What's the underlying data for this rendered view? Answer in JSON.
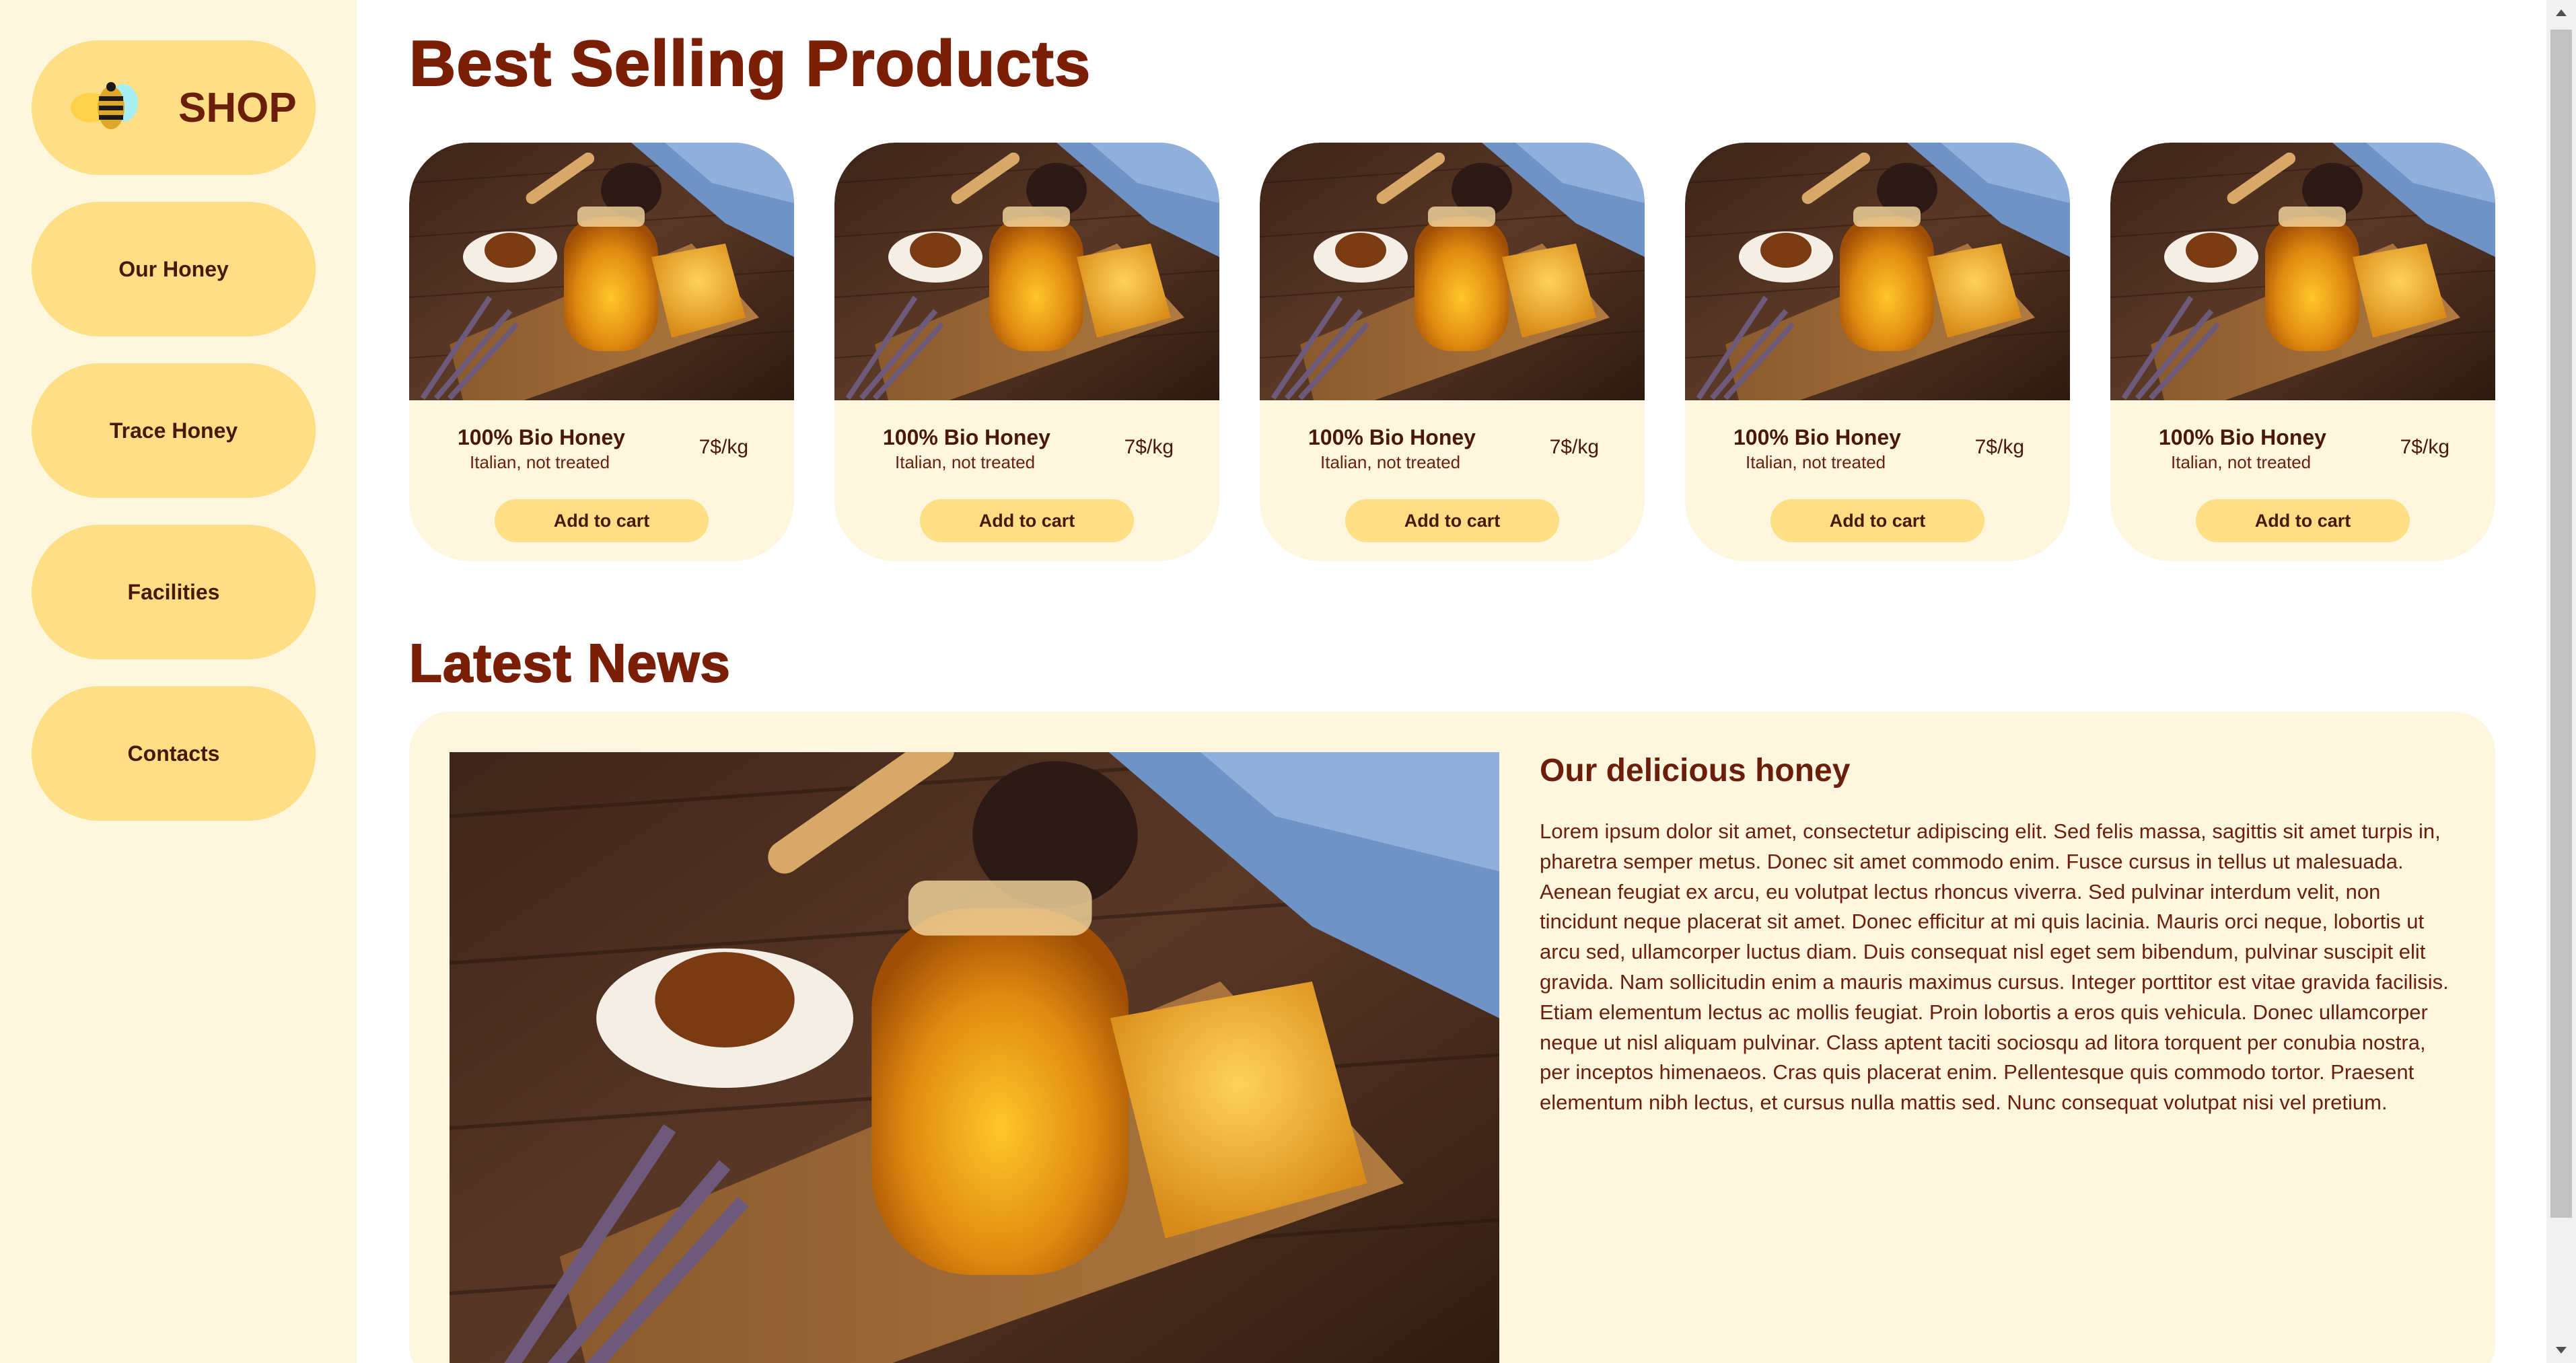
{
  "sidebar": {
    "shop_label": "SHOP",
    "items": [
      {
        "label": "Our Honey"
      },
      {
        "label": "Trace Honey"
      },
      {
        "label": "Facilities"
      },
      {
        "label": "Contacts"
      }
    ]
  },
  "best_selling": {
    "title": "Best Selling Products",
    "products": [
      {
        "name": "100% Bio Honey",
        "subtitle": "Italian, not treated",
        "price": "7$/kg",
        "button": "Add to cart"
      },
      {
        "name": "100% Bio Honey",
        "subtitle": "Italian, not treated",
        "price": "7$/kg",
        "button": "Add to cart"
      },
      {
        "name": "100% Bio Honey",
        "subtitle": "Italian, not treated",
        "price": "7$/kg",
        "button": "Add to cart"
      },
      {
        "name": "100% Bio Honey",
        "subtitle": "Italian, not treated",
        "price": "7$/kg",
        "button": "Add to cart"
      },
      {
        "name": "100% Bio Honey",
        "subtitle": "Italian, not treated",
        "price": "7$/kg",
        "button": "Add to cart"
      }
    ]
  },
  "news": {
    "title": "Latest News",
    "heading": "Our delicious honey",
    "body": "Lorem ipsum dolor sit amet, consectetur adipiscing elit. Sed felis massa, sagittis sit amet turpis in, pharetra semper metus. Donec sit amet commodo enim. Fusce cursus in tellus ut malesuada. Aenean feugiat ex arcu, eu volutpat lectus rhoncus viverra. Sed pulvinar interdum velit, non tincidunt neque placerat sit amet. Donec efficitur at mi quis lacinia. Mauris orci neque, lobortis ut arcu sed, ullamcorper luctus diam. Duis consequat nisl eget sem bibendum, pulvinar suscipit elit gravida. Nam sollicitudin enim a mauris maximus cursus. Integer porttitor est vitae gravida facilisis. Etiam elementum lectus ac mollis feugiat. Proin lobortis a eros quis vehicula. Donec ullamcorper neque ut nisl aliquam pulvinar. Class aptent taciti sociosqu ad litora torquent per conubia nostra, per inceptos himenaeos. Cras quis placerat enim. Pellentesque quis commodo tortor. Praesent elementum nibh lectus, et cursus nulla mattis sed. Nunc consequat volutpat nisi vel pretium."
  },
  "colors": {
    "sidebar_bg": "#fff6e0",
    "pill": "#ffdf85",
    "title": "#7a1f06",
    "text": "#6b1f0a"
  },
  "icons": {
    "logo": "bee-icon",
    "product_image": "honey-jar-image"
  }
}
